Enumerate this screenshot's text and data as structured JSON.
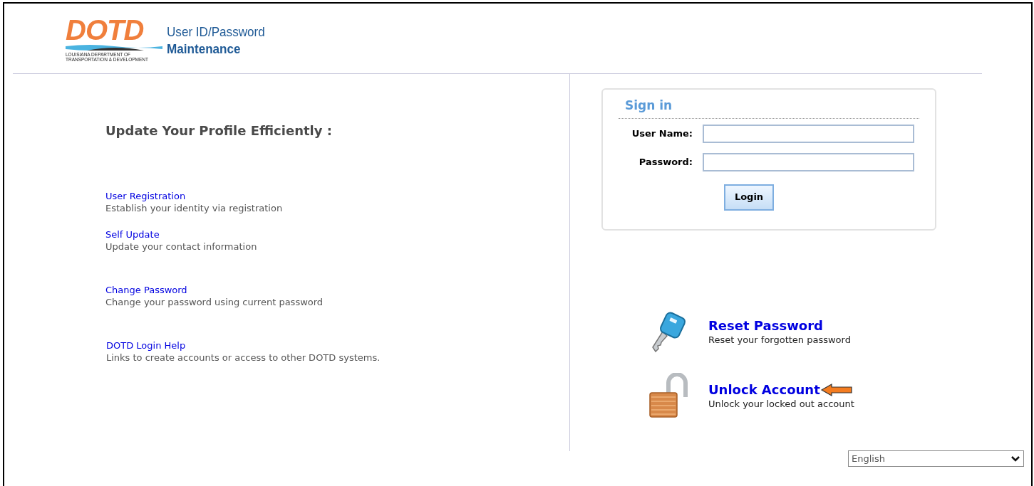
{
  "header": {
    "logo": {
      "wordmark": "DOTD",
      "agency_line_1": "LOUISIANA DEPARTMENT OF",
      "agency_line_2": "TRANSPORTATION & DEVELOPMENT"
    },
    "title_line_1": "User ID/Password",
    "title_line_2": "Maintenance"
  },
  "left": {
    "heading": "Update Your Profile Efficiently :",
    "links": [
      {
        "label": "User Registration",
        "description": "Establish your identity via registration"
      },
      {
        "label": "Self Update",
        "description": "Update your contact information"
      },
      {
        "label": "Change Password",
        "description": "Change your password using current password"
      },
      {
        "label": "DOTD Login Help",
        "description": "Links to create accounts or access to other DOTD systems."
      }
    ]
  },
  "sign_in": {
    "title": "Sign in",
    "fields": [
      {
        "label": "User Name:"
      },
      {
        "label": "Password:"
      }
    ],
    "button": "Login"
  },
  "actions": [
    {
      "kind": "key",
      "label": "Reset Password",
      "description": "Reset your forgotten password",
      "pointer": false
    },
    {
      "kind": "lock",
      "label": "Unlock Account",
      "description": "Unlock your locked out account",
      "pointer": true
    }
  ],
  "language": {
    "value": "English"
  }
}
